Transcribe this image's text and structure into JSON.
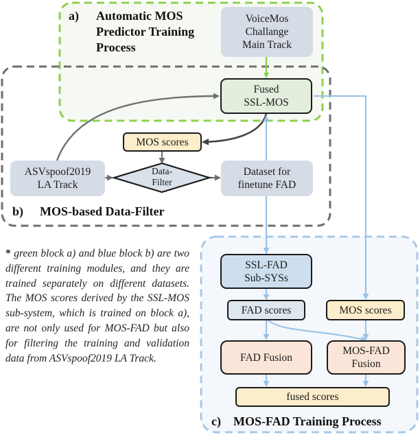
{
  "sections": {
    "a": {
      "letter": "a)",
      "title": "Automatic MOS\nPredictor Training\nProcess",
      "border_color": "#8fcf4f",
      "fill": "#f6f9f3"
    },
    "b": {
      "letter": "b)",
      "title": "MOS-based Data-Filter",
      "border_color": "#6e6e6e"
    },
    "c": {
      "letter": "c)",
      "title": "MOS-FAD Training Process",
      "border_color": "#a8c8e8",
      "fill": "#f4f8fc"
    }
  },
  "nodes": {
    "voicemos": "VoiceMos\nChallange\nMain Track",
    "fused_ssl_mos": "Fused\nSSL-MOS",
    "mos_scores_filter": "MOS scores",
    "asvspoof": "ASVspoof2019\nLA Track",
    "data_filter": "Data-\nFilter",
    "dataset_finetune": "Dataset for\nfinetune FAD",
    "ssl_fad": "SSL-FAD\nSub-SYSs",
    "fad_scores": "FAD scores",
    "mos_scores_fad": "MOS scores",
    "fad_fusion": "FAD Fusion",
    "mos_fad_fusion": "MOS-FAD\nFusion",
    "fused_scores": "fused scores"
  },
  "note": {
    "marker": "*",
    "text": "green block a) and blue block b) are two different training modules, and they are trained separately on different datasets. The MOS scores derived by the SSL-MOS sub-system, which is trained on block a), are not only used for MOS-FAD but also for filtering the training and validation data from ASVspoof2019 LA Track."
  },
  "colors": {
    "green_arrow": "#8fcf4f",
    "gray_arrow": "#707070",
    "dark_arrow": "#444444",
    "blue_arrow": "#9cc3e6"
  }
}
